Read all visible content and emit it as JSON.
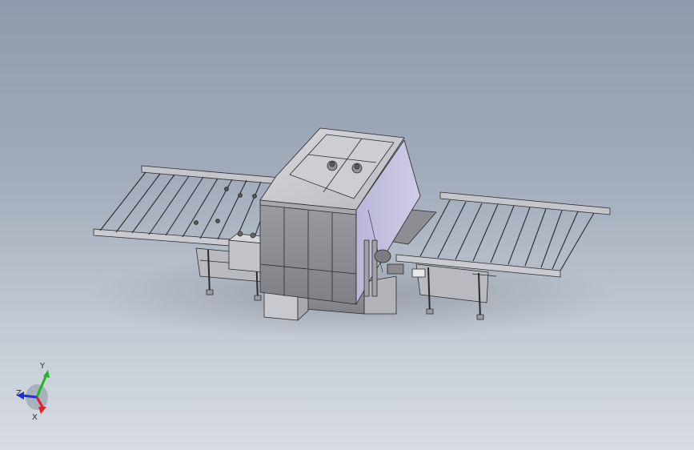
{
  "viewport": {
    "background_top": "#8f9aab",
    "background_bottom": "#d7dce2",
    "model_color": "#c9cbd0",
    "model_edge_color": "#2a2a2a"
  },
  "triad": {
    "x_label": "X",
    "y_label": "Y",
    "z_label": "Z",
    "x_color": "#e0202a",
    "y_color": "#22b522",
    "z_color": "#2030e0"
  }
}
